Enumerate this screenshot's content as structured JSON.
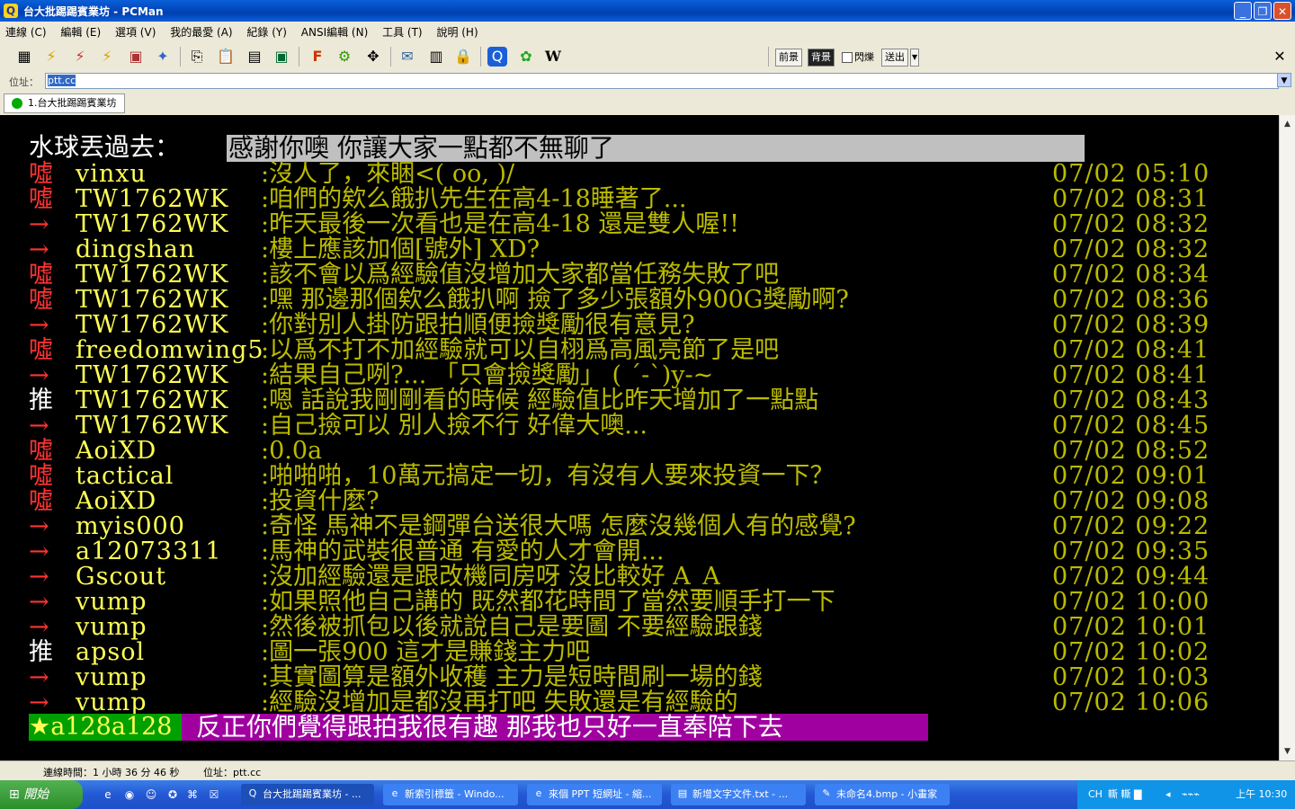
{
  "window": {
    "title": "台大批踢踢賓業坊 - PCMan",
    "minimize": "_",
    "restore": "❐",
    "close": "✕"
  },
  "menu": [
    "連線 (C)",
    "編輯 (E)",
    "選項 (V)",
    "我的最愛 (A)",
    "紀錄 (Y)",
    "ANSI編輯 (N)",
    "工具 (T)",
    "說明 (H)"
  ],
  "toolbar": {
    "front_label": "前景",
    "back_label": "背景",
    "blink_label": "閃爍",
    "send_label": "送出",
    "wiki_label": "W",
    "font_label": "F",
    "close_label": "✕"
  },
  "address": {
    "label": "位址：",
    "value": "ptt.cc"
  },
  "tab": {
    "label": "1.台大批踢踢賓業坊"
  },
  "terminal": {
    "header_label": "水球丟過去：",
    "header_text": "感謝你噢 你讓大家一點都不無聊了",
    "comments": [
      {
        "tag": "噓",
        "user": "vinxu",
        "msg": ":沒人了，來睏<(  oo,  )/",
        "time": "07/02 05:10"
      },
      {
        "tag": "噓",
        "user": "TW1762WK",
        "msg": ":咱們的欸么餓扒先生在高4-18睡著了...",
        "time": "07/02 08:31"
      },
      {
        "tag": "→",
        "user": "TW1762WK",
        "msg": ":昨天最後一次看也是在高4-18 還是雙人喔!!",
        "time": "07/02 08:32"
      },
      {
        "tag": "→",
        "user": "dingshan",
        "msg": ":樓上應該加個[號外] XD?",
        "time": "07/02 08:32"
      },
      {
        "tag": "噓",
        "user": "TW1762WK",
        "msg": ":該不會以爲經驗值沒增加大家都當任務失敗了吧",
        "time": "07/02 08:34"
      },
      {
        "tag": "噓",
        "user": "TW1762WK",
        "msg": ":嘿 那邊那個欸么餓扒啊 撿了多少張額外900G獎勵啊?",
        "time": "07/02 08:36"
      },
      {
        "tag": "→",
        "user": "TW1762WK",
        "msg": ":你對別人掛防跟拍順便撿獎勵很有意見?",
        "time": "07/02 08:39"
      },
      {
        "tag": "噓",
        "user": "freedomwing5",
        "msg": ":以爲不打不加經驗就可以自栩爲高風亮節了是吧",
        "time": "07/02 08:41"
      },
      {
        "tag": "→",
        "user": "TW1762WK",
        "msg": ":結果自己咧?... 「只會撿獎勵」 (  ´-`)y-~",
        "time": "07/02 08:41"
      },
      {
        "tag": "推",
        "user": "TW1762WK",
        "msg": ":嗯 話說我剛剛看的時候 經驗值比昨天增加了一點點",
        "time": "07/02 08:43"
      },
      {
        "tag": "→",
        "user": "TW1762WK",
        "msg": ":自己撿可以  別人撿不行  好偉大噢...",
        "time": "07/02 08:45"
      },
      {
        "tag": "噓",
        "user": "AoiXD",
        "msg": ":0.0a",
        "time": "07/02 08:52"
      },
      {
        "tag": "噓",
        "user": "tactical",
        "msg": ":啪啪啪，10萬元搞定一切，有沒有人要來投資一下？",
        "time": "07/02 09:01"
      },
      {
        "tag": "噓",
        "user": "AoiXD",
        "msg": ":投資什麼?",
        "time": "07/02 09:08"
      },
      {
        "tag": "→",
        "user": "myis000",
        "msg": ":奇怪 馬神不是鋼彈台送很大嗎 怎麼沒幾個人有的感覺?",
        "time": "07/02 09:22"
      },
      {
        "tag": "→",
        "user": "a12073311",
        "msg": ":馬神的武裝很普通 有愛的人才會開...",
        "time": "07/02 09:35"
      },
      {
        "tag": "→",
        "user": "Gscout",
        "msg": ":沒加經驗還是跟改機同房呀 沒比較好 A_A",
        "time": "07/02 09:44"
      },
      {
        "tag": "→",
        "user": "vump",
        "msg": ":如果照他自己講的  既然都花時間了當然要順手打一下",
        "time": "07/02 10:00"
      },
      {
        "tag": "→",
        "user": "vump",
        "msg": ":然後被抓包以後就說自己是要圖  不要經驗跟錢",
        "time": "07/02 10:01"
      },
      {
        "tag": "推",
        "user": "apsol",
        "msg": ":圖一張900  這才是賺錢主力吧",
        "time": "07/02 10:02"
      },
      {
        "tag": "→",
        "user": "vump",
        "msg": ":其實圖算是額外收穫  主力是短時間刷一場的錢",
        "time": "07/02 10:03"
      },
      {
        "tag": "→",
        "user": "vump",
        "msg": ":經驗沒增加是都沒再打吧  失敗還是有經驗的",
        "time": "07/02 10:06"
      }
    ],
    "bottom_user": "★a128a128",
    "bottom_msg": "反正你們覺得跟拍我很有趣 那我也只好一直奉陪下去"
  },
  "status": {
    "connection_time": "連線時間：1 小時 36 分 46 秒",
    "address": "位址：ptt.cc"
  },
  "taskbar": {
    "start_label": "開始",
    "tasks": [
      "台大批踢踢賓業坊 - ...",
      "新索引標籤 - Windo...",
      "來個 PPT 短網址 - 縮...",
      "新增文字文件.txt - ...",
      "未命名4.bmp - 小畫家"
    ],
    "tray_lang": "CH",
    "tray_ime": "䡳 䡳 ▇",
    "clock": "上午 10:30"
  },
  "colors": {
    "boo": "#ff3333",
    "arrow": "#ff3333",
    "push": "#ffffff",
    "user": "#ffff55",
    "message": "#bbbb00"
  }
}
